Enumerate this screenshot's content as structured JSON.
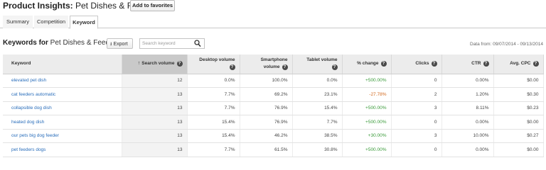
{
  "header": {
    "title_strong": "Product Insights:",
    "title_sub": " Pet Dishes & Feeders",
    "favorites_label": "Add to favorites"
  },
  "tabs": [
    {
      "label": "Summary",
      "active": false
    },
    {
      "label": "Competition",
      "active": false
    },
    {
      "label": "Keyword",
      "active": true
    }
  ],
  "toolbar": {
    "title_bold": "Keywords for",
    "title_rest": " Pet Dishes & Feeders",
    "export_label": "Export",
    "search_placeholder": "Search keyword",
    "date_range": "Data from: 09/07/2014 - 09/13/2014"
  },
  "table": {
    "headers": {
      "keyword": "Keyword",
      "search_volume": "Search volume",
      "desktop_volume": "Desktop volume",
      "smartphone_volume_1": "Smartphone",
      "smartphone_volume_2": "volume",
      "tablet_volume": "Tablet volume",
      "pct_change": "% change",
      "clicks": "Clicks",
      "ctr": "CTR",
      "avg_cpc": "Avg. CPC"
    },
    "rows": [
      {
        "keyword": "elevated pet dish",
        "search_volume": "12",
        "desktop": "0.0%",
        "smartphone": "100.0%",
        "tablet": "0.0%",
        "change": "+500.00%",
        "clicks": "0",
        "ctr": "0.00%",
        "cpc": "$0.00"
      },
      {
        "keyword": "cat feeders automatic",
        "search_volume": "13",
        "desktop": "7.7%",
        "smartphone": "69.2%",
        "tablet": "23.1%",
        "change": "-27.78%",
        "clicks": "2",
        "ctr": "1.20%",
        "cpc": "$0.30"
      },
      {
        "keyword": "collapsible dog dish",
        "search_volume": "13",
        "desktop": "7.7%",
        "smartphone": "76.9%",
        "tablet": "15.4%",
        "change": "+500.00%",
        "clicks": "3",
        "ctr": "8.11%",
        "cpc": "$0.23"
      },
      {
        "keyword": "heated dog dish",
        "search_volume": "13",
        "desktop": "15.4%",
        "smartphone": "76.9%",
        "tablet": "7.7%",
        "change": "+500.00%",
        "clicks": "0",
        "ctr": "0.00%",
        "cpc": "$0.00"
      },
      {
        "keyword": "our pets big dog feeder",
        "search_volume": "13",
        "desktop": "15.4%",
        "smartphone": "46.2%",
        "tablet": "38.5%",
        "change": "+30.00%",
        "clicks": "3",
        "ctr": "10.00%",
        "cpc": "$0.27"
      },
      {
        "keyword": "pet feeders dogs",
        "search_volume": "13",
        "desktop": "7.7%",
        "smartphone": "61.5%",
        "tablet": "30.8%",
        "change": "+500.00%",
        "clicks": "0",
        "ctr": "0.00%",
        "cpc": "$0.00"
      }
    ]
  },
  "colors": {
    "link": "#2a6ebb",
    "positive": "#3a9b3a",
    "negative": "#d2691e",
    "header_bg": "#ececec",
    "sorted_header_bg": "#c9c9c9"
  },
  "icons": {
    "help": "question-circle-icon",
    "export": "download-icon",
    "search": "magnifier-icon",
    "sort": "arrow-up-icon"
  }
}
